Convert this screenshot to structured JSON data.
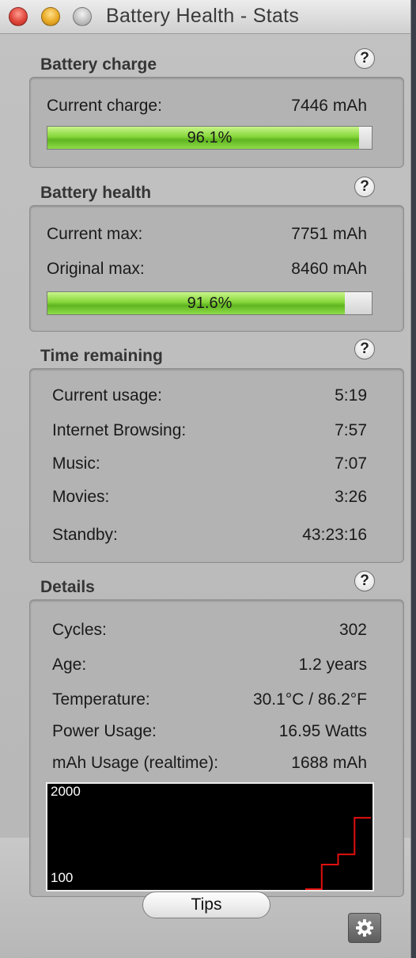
{
  "window": {
    "title": "Battery Health - Stats"
  },
  "charge": {
    "title": "Battery charge",
    "current_label": "Current charge:",
    "current_value": "7446 mAh",
    "percent_text": "96.1%",
    "percent": 96.1
  },
  "health": {
    "title": "Battery health",
    "current_max_label": "Current max:",
    "current_max_value": "7751 mAh",
    "original_max_label": "Original max:",
    "original_max_value": "8460 mAh",
    "percent_text": "91.6%",
    "percent": 91.6
  },
  "time": {
    "title": "Time remaining",
    "rows": [
      {
        "label": "Current usage:",
        "value": "5:19"
      },
      {
        "label": "Internet Browsing:",
        "value": "7:57"
      },
      {
        "label": "Music:",
        "value": "7:07"
      },
      {
        "label": "Movies:",
        "value": "3:26"
      },
      {
        "label": "Standby:",
        "value": "43:23:16"
      }
    ]
  },
  "details": {
    "title": "Details",
    "rows": [
      {
        "label": "Cycles:",
        "value": "302"
      },
      {
        "label": "Age:",
        "value": "1.2 years"
      },
      {
        "label": "Temperature:",
        "value": "30.1°C / 86.2°F"
      },
      {
        "label": "Power Usage:",
        "value": "16.95 Watts"
      },
      {
        "label": "mAh Usage (realtime):",
        "value": "1688 mAh"
      }
    ]
  },
  "chart_data": {
    "type": "line",
    "ylim": [
      100,
      2000
    ],
    "tick_labels": [
      "2000",
      "100"
    ],
    "series": [
      {
        "color": "#e01010",
        "x": [
          0,
          1,
          1,
          2,
          2,
          3,
          3,
          4
        ],
        "values": [
          100,
          100,
          650,
          650,
          880,
          880,
          1700,
          1700
        ]
      }
    ]
  },
  "colors": {
    "graph_line": "#e01010",
    "bar_fill": "#78cf35"
  },
  "help_glyph": "?",
  "buttons": {
    "tips": "Tips",
    "settings_icon": "gear-icon"
  }
}
